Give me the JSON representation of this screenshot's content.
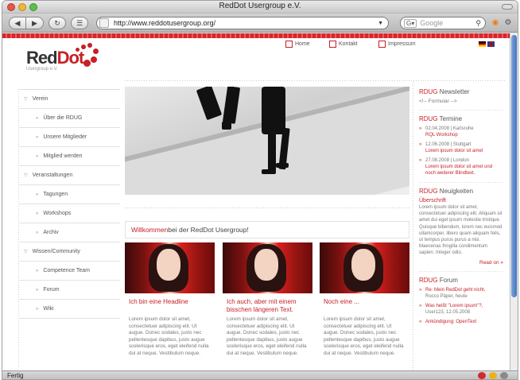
{
  "window": {
    "title": "RedDot Usergroup e.V.",
    "status": "Fertig"
  },
  "toolbar": {
    "url": "http://www.reddotusergroup.org/",
    "search_placeholder": "Google"
  },
  "logo": {
    "part1": "Red",
    "part2": "Dot",
    "sub": "Usergroup e.V."
  },
  "topnav": {
    "home": "Home",
    "kontakt": "Kontakt",
    "impressum": "Impressum"
  },
  "sidebar": {
    "items": [
      {
        "label": "Verein",
        "level": "top"
      },
      {
        "label": "Über die RDUG",
        "level": "sub"
      },
      {
        "label": "Unsere Mitglieder",
        "level": "sub"
      },
      {
        "label": "Mitglied werden",
        "level": "sub"
      },
      {
        "label": "Veranstaltungen",
        "level": "top"
      },
      {
        "label": "Tagungen",
        "level": "sub"
      },
      {
        "label": "Workshops",
        "level": "sub"
      },
      {
        "label": "Archiv",
        "level": "sub"
      },
      {
        "label": "Wissen/Community",
        "level": "top"
      },
      {
        "label": "Competence Team",
        "level": "sub"
      },
      {
        "label": "Forum",
        "level": "sub"
      },
      {
        "label": "Wiki",
        "level": "sub"
      }
    ]
  },
  "welcome": {
    "red": "Willkommen",
    "rest": " bei der RedDot Usergroup!"
  },
  "cards": [
    {
      "headline": "Ich bin eine Headline",
      "body": "Lorem ipsum dolor sit amet, consectetuer adipiscing elit. Ut augue. Donec sodales, justo nec pellentesque dapibus, justo augue scelerisque eros, eget eleifend nulla dui at neque. Vestibulum neque."
    },
    {
      "headline": "Ich auch, aber mit einem bisschen längeren Text.",
      "body": "Lorem ipsum dolor sit amet, consectetuer adipiscing elit. Ut augue. Donec sodales, justo nec pellentesque dapibus, justo augue scelerisque eros, eget eleifend nulla dui at neque. Vestibulum neque."
    },
    {
      "headline": "Noch eine ...",
      "body": "Lorem ipsum dolor sit amet, consectetuer adipiscing elit. Ut augue. Donec sodales, justo nec pellentesque dapibus, justo augue scelerisque eros, eget eleifend nulla dui at neque. Vestibulum neque."
    }
  ],
  "right": {
    "brand": "RDUG",
    "newsletter": {
      "title": "Newsletter",
      "text": "<!-- Formular -->"
    },
    "termine": {
      "title": "Termine",
      "events": [
        {
          "meta": "02.04.2008 | Karlsruhe",
          "link": "RQL Workshop"
        },
        {
          "meta": "12.06.2008 | Stuttgart",
          "link": "Lorem ipsum dolor sit amet"
        },
        {
          "meta": "27.08.2008 | London",
          "link": "Lorem ipsum dolor sit amet und noch weiterer Blindtext."
        }
      ]
    },
    "neuigkeiten": {
      "title": "Neuigkeiten",
      "heading": "Überschrift",
      "text": "Lorem ipsum dolor sit amet, consectetuer adipiscing elit. Aliquam sit amet dui eget ipsum molestie tristique. Quisque bibendum, lorem nec euismod ullamcorper, libero quam aliquam felis, ut tempus purus purus a nisi. Maecenas fringilla condimentum sapien. Integer odio.",
      "readon": "Read on »"
    },
    "forum": {
      "title": "Forum",
      "posts": [
        {
          "link": "Re: Mein RedDot geht nicht,",
          "meta": "Rocco Päper, heute"
        },
        {
          "link": "Was heißt \"Lorem ipsum\"?,",
          "meta": "User123, 12.05.2008"
        },
        {
          "link": "Ankündigung: OpenText",
          "meta": ""
        }
      ]
    }
  },
  "colors": {
    "brand_red": "#c72026"
  }
}
